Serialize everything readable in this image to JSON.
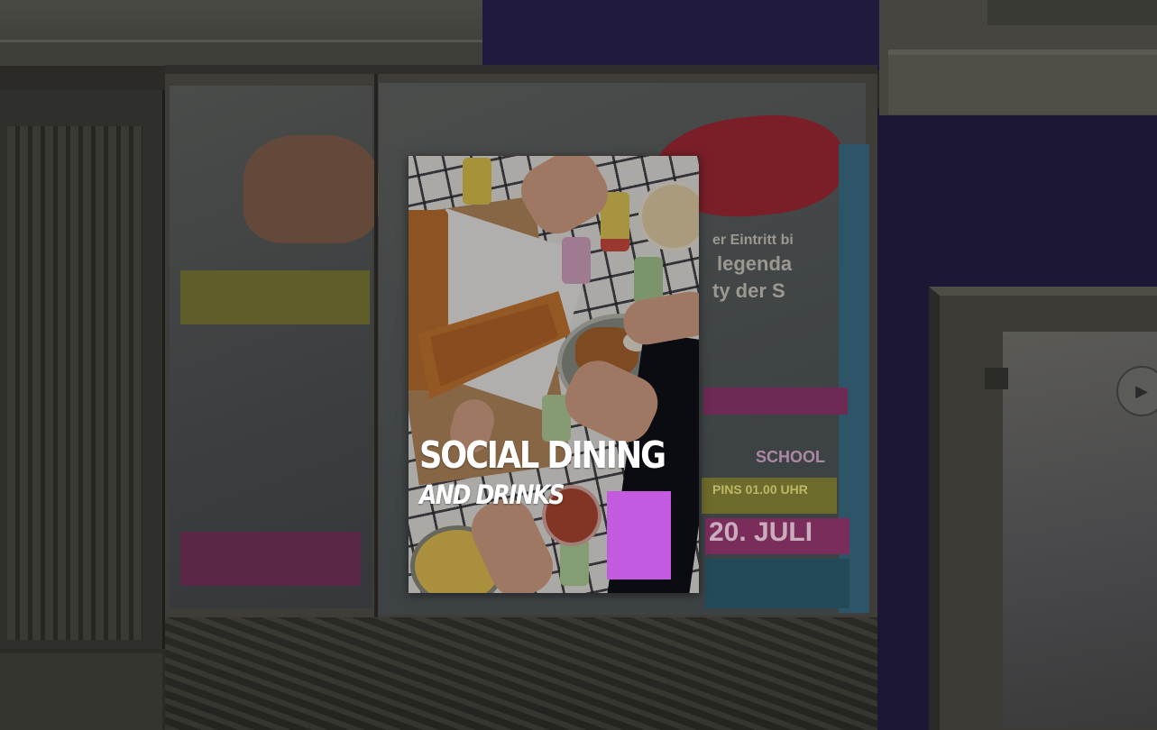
{
  "poster": {
    "headline": "SOCIAL DINING",
    "subline": "AND DRINKS",
    "accent_color": "#c25be0",
    "text_color": "#ffffff"
  },
  "wall_posters": {
    "line1": "er Eintritt bi",
    "line2": "legenda",
    "line3": "ty der S",
    "line4": "SCHOOL",
    "line5": "PINS 01.00 UHR",
    "line6": "20. JULI"
  },
  "sticker": {
    "icon": "play-icon"
  }
}
